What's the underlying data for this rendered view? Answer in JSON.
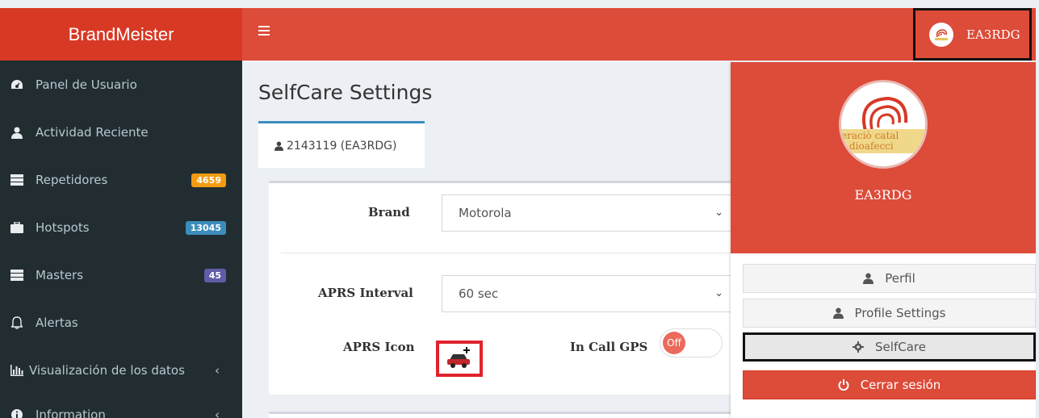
{
  "brand": "BrandMeister",
  "sidebar": {
    "items": [
      {
        "label": "Panel de Usuario",
        "icon": "dashboard-icon"
      },
      {
        "label": "Actividad Reciente",
        "icon": "user-icon"
      },
      {
        "label": "Repetidores",
        "icon": "server-icon",
        "badge": "4659"
      },
      {
        "label": "Hotspots",
        "icon": "briefcase-icon",
        "badge": "13045"
      },
      {
        "label": "Masters",
        "icon": "server-icon",
        "badge": "45"
      },
      {
        "label": "Alertas",
        "icon": "bell-icon"
      },
      {
        "label": "Visualización de los datos",
        "icon": "bar-chart-icon"
      },
      {
        "label": "Information",
        "icon": "info-icon"
      }
    ]
  },
  "topbar": {
    "username": "EA3RDG"
  },
  "page": {
    "title": "SelfCare Settings",
    "tab_label": "2143119 (EA3RDG)"
  },
  "form": {
    "brand_label": "Brand",
    "brand_value": "Motorola",
    "aprs_interval_label": "APRS Interval",
    "aprs_interval_value": "60 sec",
    "aprs_icon_label": "APRS Icon",
    "in_call_gps_label": "In Call GPS",
    "in_call_gps_state": "Off"
  },
  "user_menu": {
    "name": "EA3RDG",
    "avatar_text_1": "eraciò catal",
    "avatar_text_2": "dioafecci",
    "items": [
      {
        "label": "Perfil"
      },
      {
        "label": "Profile Settings"
      },
      {
        "label": "SelfCare"
      },
      {
        "label": "Cerrar sesión"
      }
    ]
  },
  "colors": {
    "brand_red": "#dd4b39",
    "sidebar_dark": "#222d32",
    "badge_orange": "#f39c12",
    "badge_blue": "#3c8dbc",
    "badge_purple": "#605ca8"
  }
}
